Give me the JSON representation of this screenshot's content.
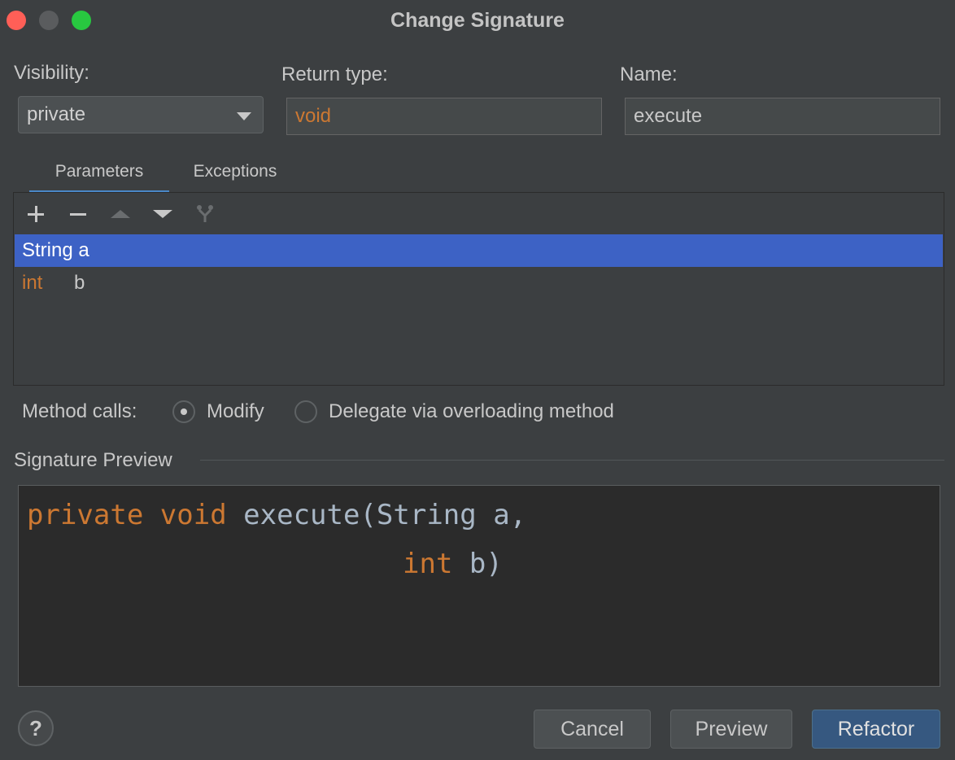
{
  "window": {
    "title": "Change Signature"
  },
  "visibility": {
    "label": "Visibility:",
    "value": "private"
  },
  "return_type": {
    "label": "Return type:",
    "value": "void"
  },
  "name": {
    "label": "Name:",
    "value": "execute"
  },
  "tabs": [
    {
      "label": "Parameters",
      "active": true
    },
    {
      "label": "Exceptions",
      "active": false
    }
  ],
  "toolbar": {
    "icons": [
      "add-icon",
      "remove-icon",
      "move-up-icon",
      "move-down-icon",
      "propagate-icon"
    ]
  },
  "parameters": [
    {
      "type": "String",
      "name": "a",
      "display": "String a",
      "selected": true
    },
    {
      "type": "int",
      "name": "b",
      "selected": false
    }
  ],
  "method_calls": {
    "label": "Method calls:",
    "options": [
      {
        "label": "Modify",
        "selected": true
      },
      {
        "label": "Delegate via overloading method",
        "selected": false
      }
    ]
  },
  "signature_preview": {
    "label": "Signature Preview",
    "line1": {
      "kw1": "private",
      "kw2": "void",
      "rest": "execute(String a,"
    },
    "line2": {
      "kw": "int",
      "rest": "b)"
    }
  },
  "buttons": {
    "help": "?",
    "cancel": "Cancel",
    "preview": "Preview",
    "refactor": "Refactor"
  },
  "colors": {
    "keyword": "#cc7832",
    "selection": "#3d62c5",
    "accent": "#4a88c7",
    "primary_button": "#365880"
  }
}
